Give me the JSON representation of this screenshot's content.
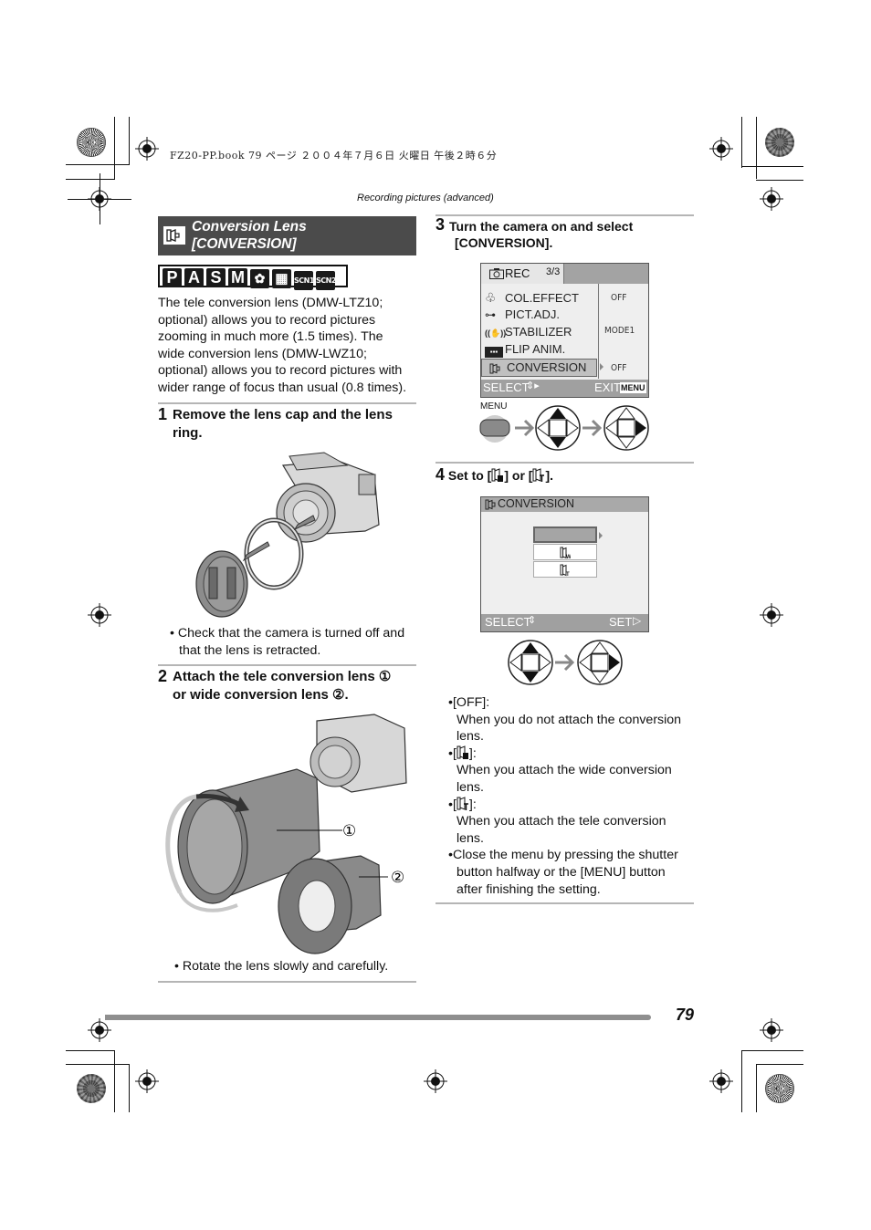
{
  "print_header": {
    "file_info": "FZ20-PP.book  79 ページ  ２００４年７月６日  火曜日  午後２時６分"
  },
  "running_header": "Recording pictures (advanced)",
  "section": {
    "icon": "conversion-lens-icon",
    "title_line1": "Conversion Lens",
    "title_line2": "[CONVERSION]"
  },
  "mode_icons": [
    {
      "label": "P",
      "name": "program-mode-icon"
    },
    {
      "label": "A",
      "name": "aperture-priority-icon"
    },
    {
      "label": "S",
      "name": "shutter-priority-icon"
    },
    {
      "label": "M",
      "name": "manual-mode-icon"
    },
    {
      "label": "✿",
      "name": "macro-mode-icon"
    },
    {
      "label": "▦",
      "name": "motion-picture-icon"
    },
    {
      "label": "SCN1",
      "name": "scene1-icon"
    },
    {
      "label": "SCN2",
      "name": "scene2-icon"
    }
  ],
  "intro": [
    "The tele conversion lens (DMW-LTZ10;",
    "optional) allows you to record pictures",
    "zooming in much more (1.5 times). The",
    "wide conversion lens (DMW-LWZ10;",
    "optional) allows you to record pictures with",
    "wider range of focus than usual (0.8 times)."
  ],
  "steps": [
    {
      "number": "1",
      "lines": [
        "Remove the lens cap and the lens",
        "ring."
      ],
      "notes": [
        "Check that the camera is turned off and",
        "that the lens is retracted."
      ]
    },
    {
      "number": "2",
      "lines": [
        "Attach the tele conversion lens ①",
        "or wide conversion lens ②."
      ],
      "callouts": [
        "①",
        "②"
      ],
      "notes": [
        "Rotate the lens slowly and carefully."
      ]
    },
    {
      "number": "3",
      "lines": [
        "Turn the camera on and select",
        "[CONVERSION]."
      ]
    },
    {
      "number": "4",
      "line": "Set to [  ] or [  ]."
    }
  ],
  "rec_menu": {
    "tab_label": "REC",
    "page": "3/3",
    "items": [
      {
        "icon": "color-effect-icon",
        "label": "COL.EFFECT",
        "value": "OFF"
      },
      {
        "icon": "picture-adjust-icon",
        "label": "PICT.ADJ.",
        "value": ""
      },
      {
        "icon": "stabilizer-icon",
        "label": "STABILIZER",
        "value": "MODE1"
      },
      {
        "icon": "flip-anim-icon",
        "label": "FLIP ANIM.",
        "value": ""
      },
      {
        "icon": "conversion-lens-icon",
        "label": "CONVERSION",
        "value": "OFF",
        "selected": true
      }
    ],
    "footer_left": "SELECT",
    "footer_right": "EXIT",
    "footer_badge": "MENU"
  },
  "menu_button_label": "MENU",
  "conversion_menu": {
    "title": "CONVERSION",
    "options": [
      {
        "label": "",
        "name": "off-option",
        "selected": true
      },
      {
        "label": "W",
        "name": "wide-option"
      },
      {
        "label": "T",
        "name": "tele-option"
      }
    ],
    "footer_left": "SELECT",
    "footer_right": "SET"
  },
  "option_notes": [
    {
      "head": "[OFF]:",
      "body": [
        "When you do not attach the conversion",
        "lens."
      ]
    },
    {
      "head": "[  ]:",
      "body": [
        "When you attach the wide conversion",
        "lens."
      ]
    },
    {
      "head": "[  ]:",
      "body": [
        "When you attach the tele conversion",
        "lens."
      ]
    },
    {
      "head": "",
      "body": [
        "Close the menu by pressing the shutter",
        "button halfway or the [MENU] button",
        "after finishing the setting."
      ]
    }
  ],
  "page_number": "79"
}
